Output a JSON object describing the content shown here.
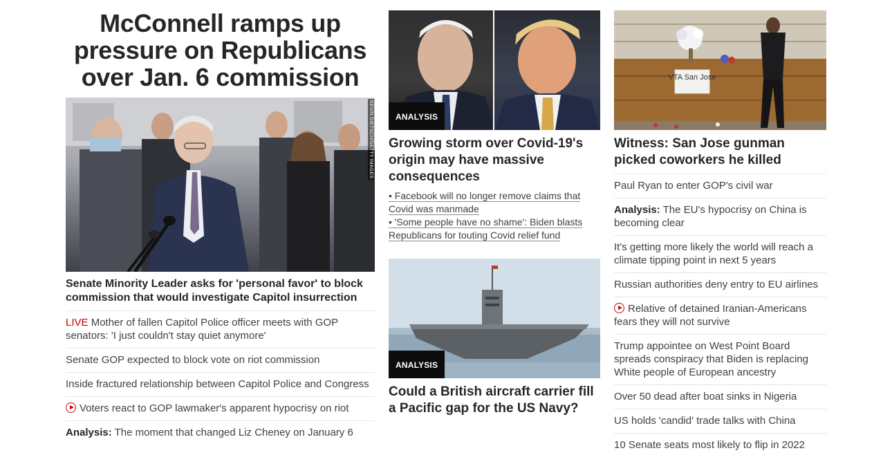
{
  "col1": {
    "headline": "McConnell ramps up pressure on Republicans over Jan. 6 commission",
    "photo_credit": "KEVIN DIETSCH/GETTY IMAGES",
    "story_title": "Senate Minority Leader asks for 'personal favor' to block commission that would investigate Capitol insurrection",
    "links": [
      {
        "prefix": "LIVE",
        "text": "Mother of fallen Capitol Police officer meets with GOP senators: 'I just couldn't stay quiet anymore'"
      },
      {
        "text": "Senate GOP expected to block vote on riot commission"
      },
      {
        "text": "Inside fractured relationship between Capitol Police and Congress"
      },
      {
        "icon": "play-icon",
        "text": "Voters react to GOP lawmaker's apparent hypocrisy on riot"
      },
      {
        "prefix": "Analysis:",
        "text": "The moment that changed Liz Cheney on January 6"
      }
    ]
  },
  "col2": {
    "story1": {
      "badge": "ANALYSIS",
      "title": "Growing storm over Covid-19's origin may have massive consequences",
      "sub_links": [
        "• Facebook will no longer remove claims that Covid was manmade",
        "• 'Some people have no shame': Biden blasts Republicans for touting Covid relief fund"
      ]
    },
    "story2": {
      "badge": "ANALYSIS",
      "title": "Could a British aircraft carrier fill a Pacific gap for the US Navy?"
    }
  },
  "col3": {
    "story_title": "Witness: San Jose gunman picked coworkers he killed",
    "sign_text": "VTA San Jose",
    "links": [
      {
        "text": "Paul Ryan to enter GOP's civil war"
      },
      {
        "prefix": "Analysis:",
        "text": "The EU's hypocrisy on China is becoming clear"
      },
      {
        "text": "It's getting more likely the world will reach a climate tipping point in next 5 years"
      },
      {
        "text": "Russian authorities deny entry to EU airlines"
      },
      {
        "icon": "play-icon",
        "text": "Relative of detained Iranian-Americans fears they will not survive"
      },
      {
        "text": "Trump appointee on West Point Board spreads conspiracy that Biden is replacing White people of European ancestry"
      },
      {
        "text": "Over 50 dead after boat sinks in Nigeria"
      },
      {
        "text": "US holds 'candid' trade talks with China"
      },
      {
        "text": "10 Senate seats most likely to flip in 2022"
      }
    ]
  },
  "colors": {
    "live": "#cc0000",
    "badge_bg": "#0c0c0c",
    "text": "#262626",
    "divider": "#e6e6e6"
  }
}
